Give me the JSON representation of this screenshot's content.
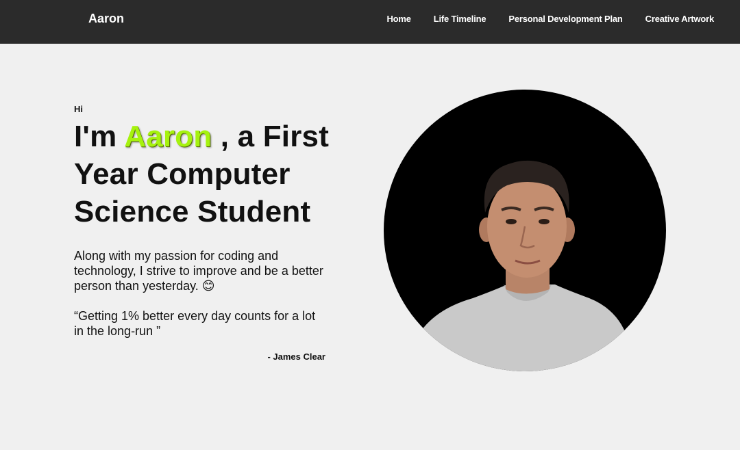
{
  "nav": {
    "brand": "Aaron",
    "links": [
      "Home",
      "Life Timeline",
      "Personal Development Plan",
      "Creative Artwork"
    ]
  },
  "hero": {
    "greeting": "Hi",
    "headline_prefix": "I'm ",
    "name": "Aaron",
    "headline_suffix": " , a First Year Computer Science Student",
    "intro": "Along with my passion for coding and technology, I strive to improve and be a better person than yesterday. 😊",
    "quote": "“Getting 1% better every day counts for a lot in the long-run ”",
    "attribution": "- James Clear"
  },
  "portrait": {
    "icon": "profile-photo"
  },
  "colors": {
    "navbar": "#2b2b2b",
    "page_background": "#f0f0f0",
    "name_highlight": "#a6f20f",
    "portrait_background": "#000000"
  }
}
